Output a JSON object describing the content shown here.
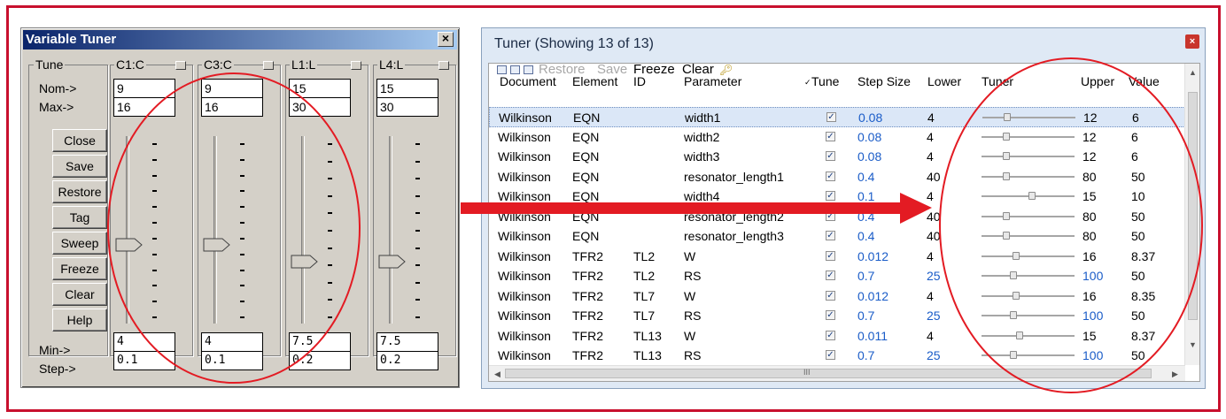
{
  "variable_tuner": {
    "title": "Variable Tuner",
    "close_glyph": "×",
    "tune_group_label": "Tune",
    "nom_label": "Nom->",
    "max_label": "Max->",
    "min_label": "Min->",
    "step_label": "Step->",
    "buttons": [
      "Close",
      "Save",
      "Restore",
      "Tag",
      "Sweep",
      "Freeze",
      "Clear",
      "Help"
    ],
    "variables": [
      {
        "name": "C1:C",
        "nom": "9",
        "max": "16",
        "min": "4",
        "step": "0.1",
        "level": 0.42
      },
      {
        "name": "C3:C",
        "nom": "9",
        "max": "16",
        "min": "4",
        "step": "0.1",
        "level": 0.42
      },
      {
        "name": "L1:L",
        "nom": "15",
        "max": "30",
        "min": "7.5",
        "step": "0.2",
        "level": 0.33
      },
      {
        "name": "L4:L",
        "nom": "15",
        "max": "30",
        "min": "7.5",
        "step": "0.2",
        "level": 0.33
      }
    ]
  },
  "tuner_window": {
    "title": "Tuner (Showing 13 of 13)",
    "close_glyph": "×",
    "toolbar": {
      "restore": "Restore",
      "save": "Save",
      "freeze": "Freeze",
      "clear": "Clear"
    },
    "columns": {
      "document": "Document",
      "element": "Element",
      "id": "ID",
      "parameter": "Parameter",
      "tune": "Tune",
      "step_size": "Step Size",
      "lower": "Lower",
      "tuner": "Tuner",
      "upper": "Upper",
      "value": "Value"
    },
    "rows": [
      {
        "document": "Wilkinson",
        "element": "EQN",
        "id": "",
        "parameter": "width1",
        "tune": "✓",
        "step": "0.08",
        "lower": "4",
        "upper": "12",
        "value": "6",
        "pos": 0.25,
        "selected": true
      },
      {
        "document": "Wilkinson",
        "element": "EQN",
        "id": "",
        "parameter": "width2",
        "tune": "✓",
        "step": "0.08",
        "lower": "4",
        "upper": "12",
        "value": "6",
        "pos": 0.25
      },
      {
        "document": "Wilkinson",
        "element": "EQN",
        "id": "",
        "parameter": "width3",
        "tune": "✓",
        "step": "0.08",
        "lower": "4",
        "upper": "12",
        "value": "6",
        "pos": 0.25
      },
      {
        "document": "Wilkinson",
        "element": "EQN",
        "id": "",
        "parameter": "resonator_length1",
        "tune": "✓",
        "step": "0.4",
        "lower": "40",
        "upper": "80",
        "value": "50",
        "pos": 0.25
      },
      {
        "document": "Wilkinson",
        "element": "EQN",
        "id": "",
        "parameter": "width4",
        "tune": "✓",
        "step": "0.1",
        "lower": "4",
        "upper": "15",
        "value": "10",
        "pos": 0.55
      },
      {
        "document": "Wilkinson",
        "element": "EQN",
        "id": "",
        "parameter": "resonator_length2",
        "tune": "✓",
        "step": "0.4",
        "lower": "40",
        "upper": "80",
        "value": "50",
        "pos": 0.25
      },
      {
        "document": "Wilkinson",
        "element": "EQN",
        "id": "",
        "parameter": "resonator_length3",
        "tune": "✓",
        "step": "0.4",
        "lower": "40",
        "upper": "80",
        "value": "50",
        "pos": 0.25
      },
      {
        "document": "Wilkinson",
        "element": "TFR2",
        "id": "TL2",
        "parameter": "W",
        "tune": "✓",
        "step": "0.012",
        "lower": "4",
        "upper": "16",
        "value": "8.37",
        "pos": 0.36
      },
      {
        "document": "Wilkinson",
        "element": "TFR2",
        "id": "TL2",
        "parameter": "RS",
        "tune": "✓",
        "step": "0.7",
        "lower": "25",
        "upper": "100",
        "value": "50",
        "pos": 0.33
      },
      {
        "document": "Wilkinson",
        "element": "TFR2",
        "id": "TL7",
        "parameter": "W",
        "tune": "✓",
        "step": "0.012",
        "lower": "4",
        "upper": "16",
        "value": "8.35",
        "pos": 0.36
      },
      {
        "document": "Wilkinson",
        "element": "TFR2",
        "id": "TL7",
        "parameter": "RS",
        "tune": "✓",
        "step": "0.7",
        "lower": "25",
        "upper": "100",
        "value": "50",
        "pos": 0.33
      },
      {
        "document": "Wilkinson",
        "element": "TFR2",
        "id": "TL13",
        "parameter": "W",
        "tune": "✓",
        "step": "0.011",
        "lower": "4",
        "upper": "15",
        "value": "8.37",
        "pos": 0.4
      },
      {
        "document": "Wilkinson",
        "element": "TFR2",
        "id": "TL13",
        "parameter": "RS",
        "tune": "✓",
        "step": "0.7",
        "lower": "25",
        "upper": "100",
        "value": "50",
        "pos": 0.33
      }
    ],
    "scroll_grip": "III"
  },
  "colors": {
    "annotation": "#e31b23",
    "frame": "#c8102e",
    "link_blue": "#1a5cc8"
  }
}
